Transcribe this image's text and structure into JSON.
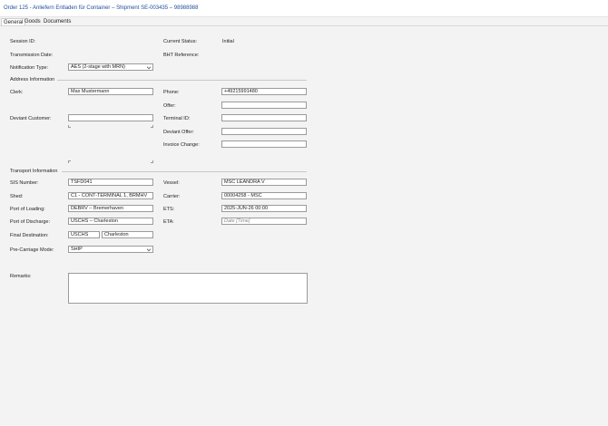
{
  "window": {
    "title": "Order 125 - Anliefern Entladen für Container – Shipment SE-003435 – 98988988"
  },
  "tabs": [
    {
      "label": "General",
      "active": true
    },
    {
      "label": "Goods",
      "active": false
    },
    {
      "label": "Documents",
      "active": false
    }
  ],
  "general": {
    "session_id_label": "Session ID:",
    "current_status_label": "Current Status:",
    "current_status_value": "Initial",
    "transmission_date_label": "Transmission Date:",
    "bht_reference_label": "BHT Reference:",
    "notification_type_label": "Notification Type:",
    "notification_type_value": "AES (2-stage with MRN)"
  },
  "address": {
    "section_title": "Address Information",
    "clerk_label": "Clerk:",
    "clerk_value": "Max Mustermann",
    "phone_label": "Phone:",
    "phone_value": "+49215991480",
    "offer_label": "Offer:",
    "offer_value": "",
    "deviant_customer_label": "Deviant Customer:",
    "deviant_customer_value": "",
    "terminal_id_label": "Terminal ID:",
    "terminal_id_value": "",
    "deviant_offer_label": "Deviant Offer:",
    "deviant_offer_value": "",
    "invoice_change_label": "Invoice Change:",
    "invoice_change_value": ""
  },
  "transport": {
    "section_title": "Transport Information",
    "sis_number_label": "SIS Number:",
    "sis_number_value": "TSFD041",
    "vessel_label": "Vessel:",
    "vessel_value": "MSC LEANDRA V",
    "shed_label": "Shed:",
    "shed_value": "C1 - CONT-TERMINAL 1, BRMHV",
    "carrier_label": "Carrier:",
    "carrier_value": "00004258 - MSC",
    "port_of_loading_label": "Port of Loading:",
    "port_of_loading_value": "DEBRV – Bremerhaven",
    "ets_label": "ETS:",
    "ets_value": "2025-JUN-26 00:00",
    "port_of_discharge_label": "Port of Discharge:",
    "port_of_discharge_value": "USCHS – Charleston",
    "eta_label": "ETA:",
    "eta_placeholder": "Date [Time]",
    "final_destination_label": "Final Destination:",
    "final_destination_code": "USCHS",
    "final_destination_name": "Charleston",
    "pre_carriage_mode_label": "Pre-Carriage Mode:",
    "pre_carriage_mode_value": "SHIP"
  },
  "remarks": {
    "label": "Remarks:",
    "value": ""
  }
}
